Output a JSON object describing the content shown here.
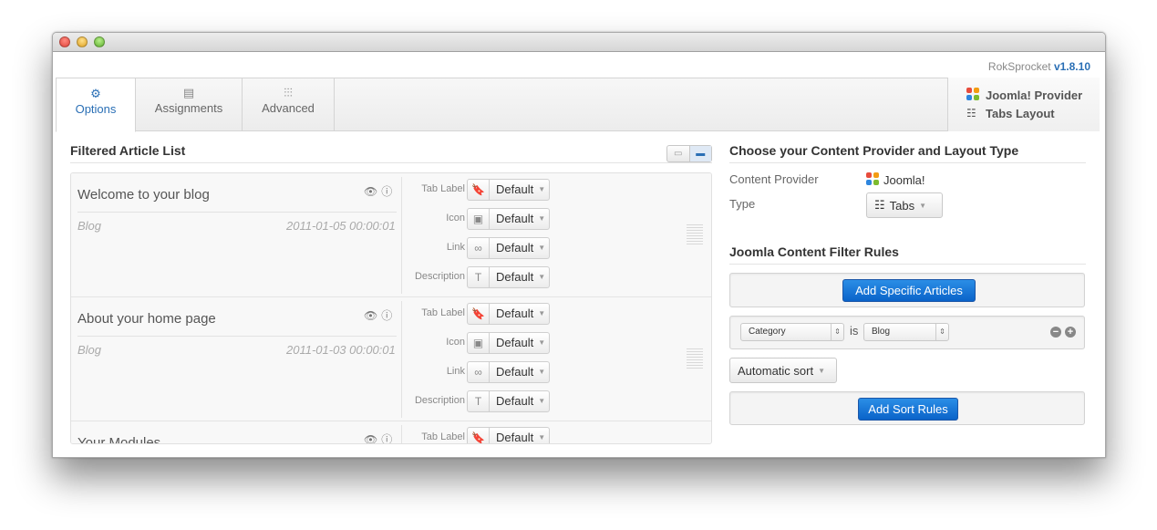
{
  "app": {
    "name": "RokSprocket",
    "version": "v1.8.10"
  },
  "tabs": [
    {
      "label": "Options",
      "icon": "gear-icon"
    },
    {
      "label": "Assignments",
      "icon": "assignments-icon"
    },
    {
      "label": "Advanced",
      "icon": "sliders-icon"
    }
  ],
  "provider_box": {
    "provider": "Joomla! Provider",
    "layout": "Tabs Layout"
  },
  "left": {
    "title": "Filtered Article List",
    "field_labels": [
      "Tab Label",
      "Icon",
      "Link",
      "Description"
    ],
    "field_value": "Default",
    "articles": [
      {
        "title": "Welcome to your blog",
        "category": "Blog",
        "date": "2011-01-05 00:00:01"
      },
      {
        "title": "About your home page",
        "category": "Blog",
        "date": "2011-01-03 00:00:01"
      },
      {
        "title": "Your Modules",
        "category": "",
        "date": ""
      }
    ]
  },
  "right": {
    "title": "Choose your Content Provider and Layout Type",
    "provider_label": "Content Provider",
    "provider_value": "Joomla!",
    "type_label": "Type",
    "type_value": "Tabs",
    "filter_title": "Joomla Content Filter Rules",
    "add_specific": "Add Specific Articles",
    "rule": {
      "field": "Category",
      "op": "is",
      "value": "Blog"
    },
    "sort": "Automatic sort",
    "add_sort": "Add Sort Rules"
  },
  "colors": {
    "accent": "#2a6fb5",
    "primary_button": "#0a63c9"
  }
}
